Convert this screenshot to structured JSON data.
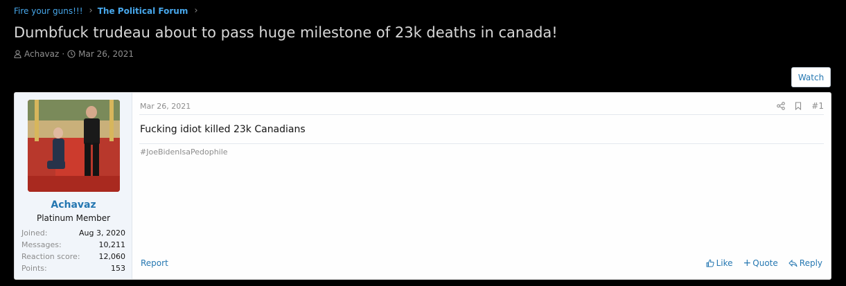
{
  "breadcrumb": {
    "items": [
      {
        "label": "Fire your guns!!!"
      },
      {
        "label": "The Political Forum"
      }
    ]
  },
  "thread": {
    "title": "Dumbfuck trudeau about to pass huge milestone of 23k deaths in canada!",
    "author": "Achavaz",
    "date": "Mar 26, 2021",
    "author_icon": "user-icon",
    "date_icon": "clock-icon"
  },
  "watch_label": "Watch",
  "post": {
    "date": "Mar 26, 2021",
    "number": "#1",
    "tools": [
      "share-icon",
      "bookmark-icon"
    ],
    "body": "Fucking idiot killed 23k Canadians",
    "hashtag": "#JoeBidenIsaPedophile",
    "report_label": "Report",
    "actions": {
      "like": "Like",
      "quote": "Quote",
      "reply": "Reply"
    }
  },
  "user": {
    "name": "Achavaz",
    "title": "Platinum Member",
    "stats": [
      {
        "label": "Joined:",
        "value": "Aug 3, 2020"
      },
      {
        "label": "Messages:",
        "value": "10,211"
      },
      {
        "label": "Reaction score:",
        "value": "12,060"
      },
      {
        "label": "Points:",
        "value": "153"
      }
    ]
  },
  "colors": {
    "link": "#47a7eb",
    "accent": "#2577b1",
    "page_bg": "#000000",
    "post_bg": "#fefefe",
    "user_panel_bg": "#f1f5fa"
  }
}
